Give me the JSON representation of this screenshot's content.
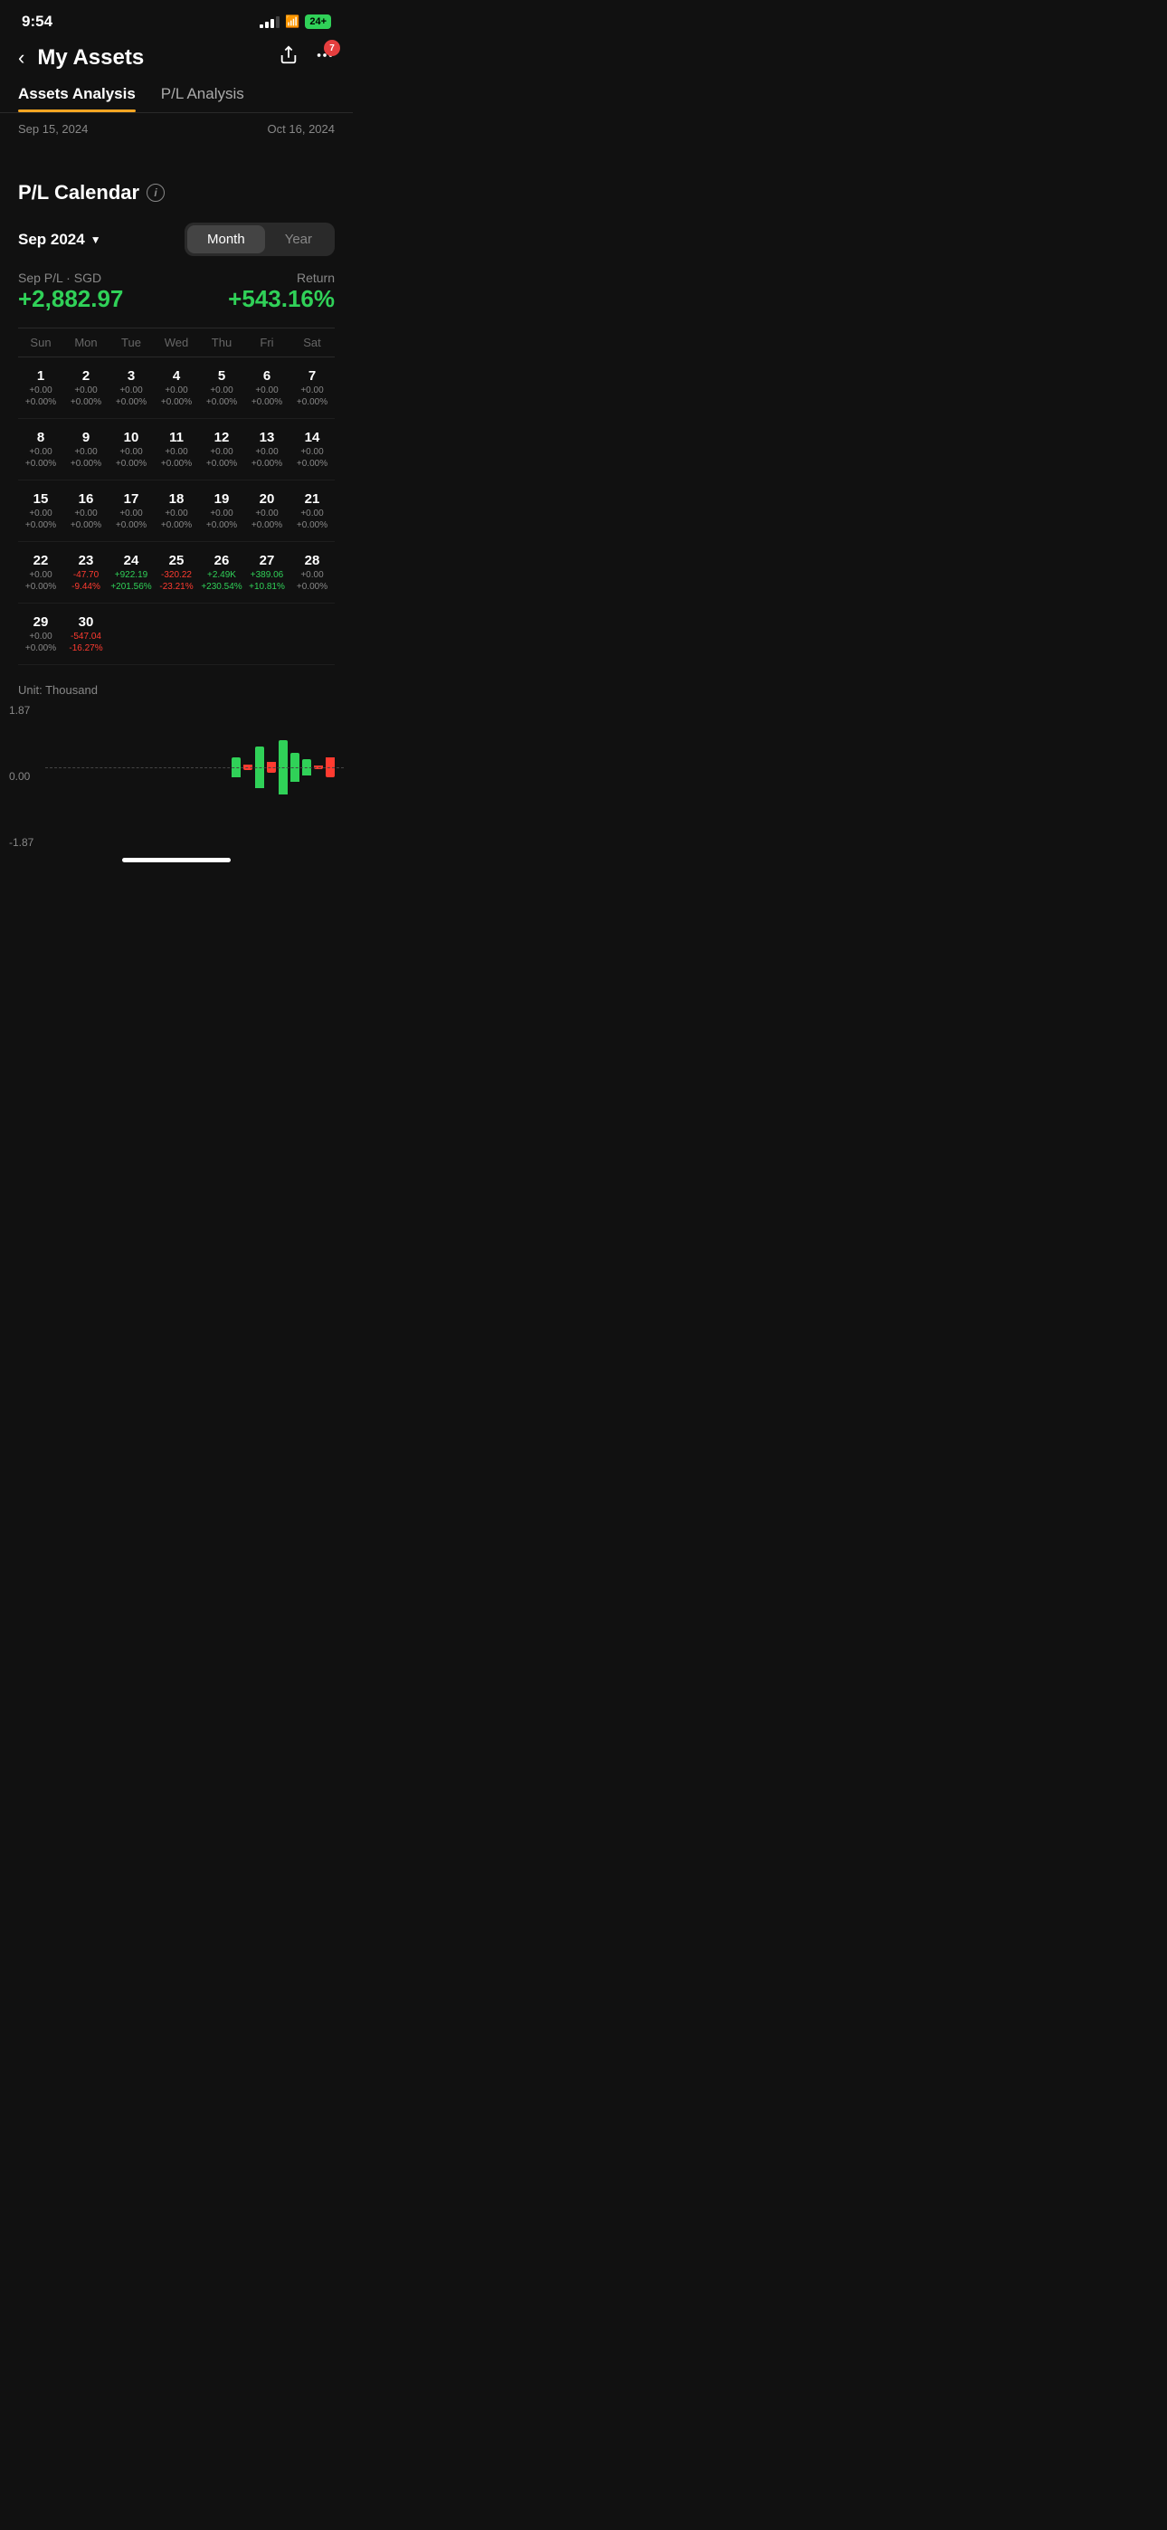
{
  "statusBar": {
    "time": "9:54",
    "bellIcon": "🔔",
    "battery": "24+",
    "signal": [
      1,
      2,
      3,
      4
    ],
    "wifi": "wifi"
  },
  "header": {
    "title": "My Assets",
    "backLabel": "‹",
    "shareIcon": "⬡",
    "moreIcon": "···",
    "notificationCount": "7"
  },
  "tabs": [
    {
      "label": "Assets Analysis",
      "active": true
    },
    {
      "label": "P/L Analysis",
      "active": false
    }
  ],
  "dateRange": {
    "start": "Sep 15, 2024",
    "end": "Oct 16, 2024"
  },
  "calendar": {
    "title": "P/L Calendar",
    "infoIcon": "i",
    "monthSelector": "Sep 2024",
    "toggleMonth": "Month",
    "toggleYear": "Year",
    "plLabel": "Sep P/L · SGD",
    "returnLabel": "Return",
    "plValue": "+2,882.97",
    "returnValue": "+543.16%",
    "dayHeaders": [
      "Sun",
      "Mon",
      "Tue",
      "Wed",
      "Thu",
      "Fri",
      "Sat"
    ],
    "weeks": [
      [
        {
          "day": "1",
          "pl": "+0.00",
          "pct": "+0.00%",
          "color": "neutral"
        },
        {
          "day": "2",
          "pl": "+0.00",
          "pct": "+0.00%",
          "color": "neutral"
        },
        {
          "day": "3",
          "pl": "+0.00",
          "pct": "+0.00%",
          "color": "neutral"
        },
        {
          "day": "4",
          "pl": "+0.00",
          "pct": "+0.00%",
          "color": "neutral"
        },
        {
          "day": "5",
          "pl": "+0.00",
          "pct": "+0.00%",
          "color": "neutral"
        },
        {
          "day": "6",
          "pl": "+0.00",
          "pct": "+0.00%",
          "color": "neutral"
        },
        {
          "day": "7",
          "pl": "+0.00",
          "pct": "+0.00%",
          "color": "neutral"
        }
      ],
      [
        {
          "day": "8",
          "pl": "+0.00",
          "pct": "+0.00%",
          "color": "neutral"
        },
        {
          "day": "9",
          "pl": "+0.00",
          "pct": "+0.00%",
          "color": "neutral"
        },
        {
          "day": "10",
          "pl": "+0.00",
          "pct": "+0.00%",
          "color": "neutral"
        },
        {
          "day": "11",
          "pl": "+0.00",
          "pct": "+0.00%",
          "color": "neutral"
        },
        {
          "day": "12",
          "pl": "+0.00",
          "pct": "+0.00%",
          "color": "neutral"
        },
        {
          "day": "13",
          "pl": "+0.00",
          "pct": "+0.00%",
          "color": "neutral"
        },
        {
          "day": "14",
          "pl": "+0.00",
          "pct": "+0.00%",
          "color": "neutral"
        }
      ],
      [
        {
          "day": "15",
          "pl": "+0.00",
          "pct": "+0.00%",
          "color": "neutral"
        },
        {
          "day": "16",
          "pl": "+0.00",
          "pct": "+0.00%",
          "color": "neutral"
        },
        {
          "day": "17",
          "pl": "+0.00",
          "pct": "+0.00%",
          "color": "neutral"
        },
        {
          "day": "18",
          "pl": "+0.00",
          "pct": "+0.00%",
          "color": "neutral"
        },
        {
          "day": "19",
          "pl": "+0.00",
          "pct": "+0.00%",
          "color": "neutral"
        },
        {
          "day": "20",
          "pl": "+0.00",
          "pct": "+0.00%",
          "color": "neutral"
        },
        {
          "day": "21",
          "pl": "+0.00",
          "pct": "+0.00%",
          "color": "neutral"
        }
      ],
      [
        {
          "day": "22",
          "pl": "+0.00",
          "pct": "+0.00%",
          "color": "neutral"
        },
        {
          "day": "23",
          "pl": "-47.70",
          "pct": "-9.44%",
          "color": "red"
        },
        {
          "day": "24",
          "pl": "+922.19",
          "pct": "+201.56%",
          "color": "green"
        },
        {
          "day": "25",
          "pl": "-320.22",
          "pct": "-23.21%",
          "color": "red"
        },
        {
          "day": "26",
          "pl": "+2.49K",
          "pct": "+230.54%",
          "color": "green"
        },
        {
          "day": "27",
          "pl": "+389.06",
          "pct": "+10.81%",
          "color": "green"
        },
        {
          "day": "28",
          "pl": "+0.00",
          "pct": "+0.00%",
          "color": "neutral"
        }
      ],
      [
        {
          "day": "29",
          "pl": "+0.00",
          "pct": "+0.00%",
          "color": "neutral"
        },
        {
          "day": "30",
          "pl": "-547.04",
          "pct": "-16.27%",
          "color": "red"
        },
        null,
        null,
        null,
        null,
        null
      ]
    ]
  },
  "chart": {
    "unitLabel": "Unit: Thousand",
    "yLabels": [
      "1.87",
      "0.00",
      "-1.87"
    ],
    "bars": [
      {
        "positive": 0,
        "negative": 0
      },
      {
        "positive": 0,
        "negative": 0
      },
      {
        "positive": 0,
        "negative": 0
      },
      {
        "positive": 30,
        "negative": 0
      },
      {
        "positive": 0,
        "negative": 8
      },
      {
        "positive": 65,
        "negative": 0
      },
      {
        "positive": 0,
        "negative": 18
      },
      {
        "positive": 85,
        "negative": 0
      },
      {
        "positive": 45,
        "negative": 0
      },
      {
        "positive": 25,
        "negative": 0
      },
      {
        "positive": 0,
        "negative": 6
      },
      {
        "positive": 0,
        "negative": 30
      }
    ]
  }
}
